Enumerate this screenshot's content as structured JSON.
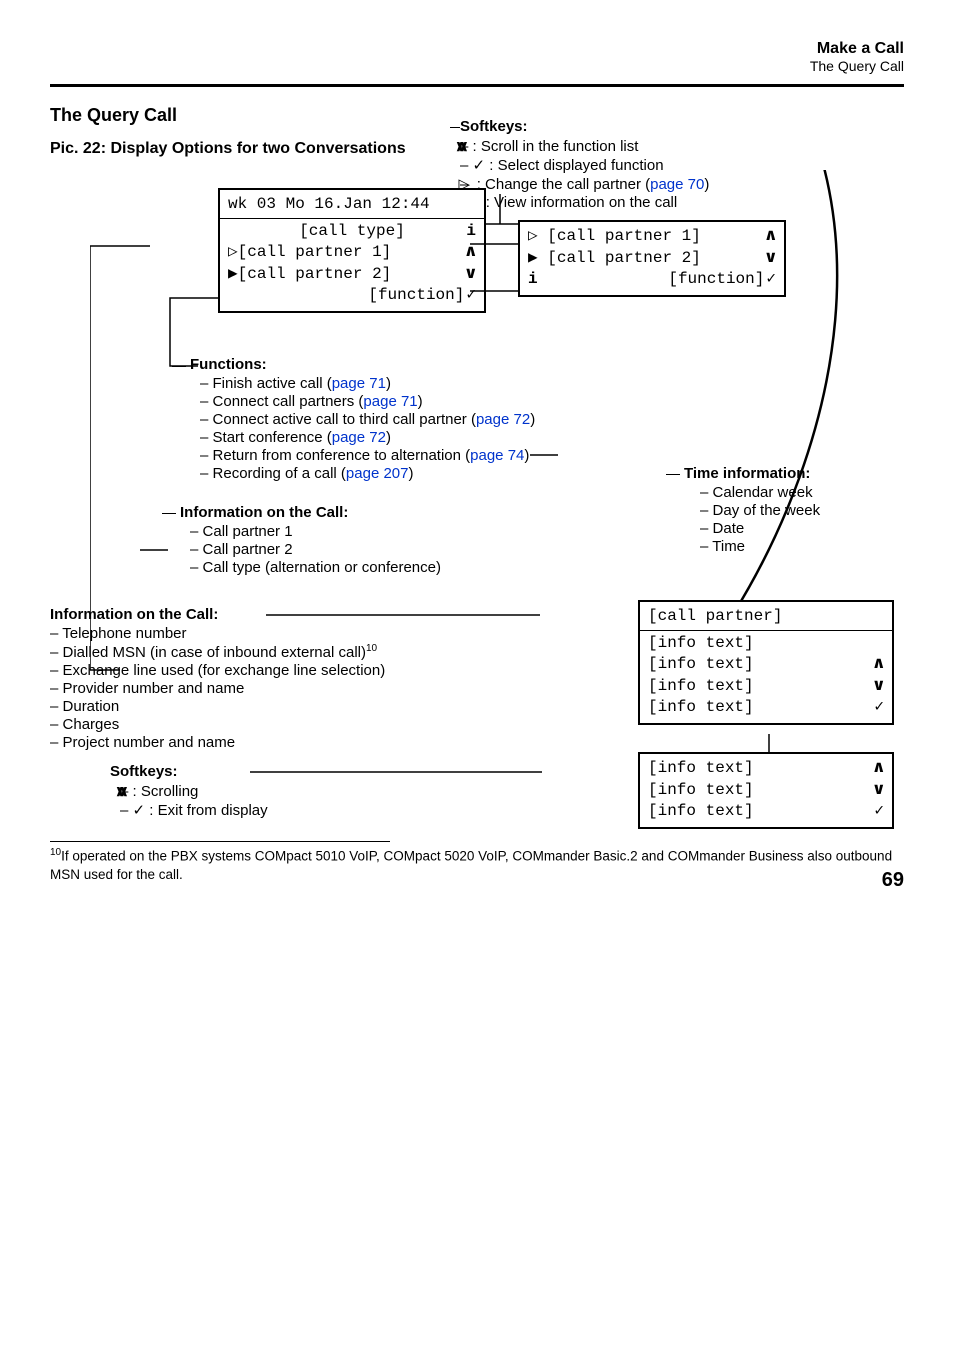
{
  "header": {
    "title": "Make a Call",
    "subtitle": "The Query Call"
  },
  "section_title": "The Query Call",
  "pic_title": "Pic. 22: Display Options for two Conversations",
  "softkeys_top": {
    "title": "Softkeys:",
    "items": [
      {
        "prefix_icon": "updown",
        "text": ": Scroll in the function list",
        "ref": ""
      },
      {
        "prefix_icon": "check",
        "text": ": Select displayed function",
        "ref": ""
      },
      {
        "prefix_icon": "play",
        "text": ": Change the call partner (",
        "ref": "page 70",
        "suffix": ")"
      },
      {
        "prefix_icon": "info",
        "text": ": View information on the call",
        "ref": ""
      }
    ]
  },
  "lcd_main": {
    "line1": "wk 03 Mo 16.Jan 12:44",
    "line2_left": "[call type]",
    "line3_left": "[call partner 1]",
    "line4_left": "[call partner 2]",
    "line5_left": "[function]"
  },
  "lcd_side": {
    "line1_left": "[call partner 1]",
    "line2_left": "[call partner 2]",
    "line3_left": "[function]"
  },
  "functions": {
    "title": "Functions:",
    "items": [
      {
        "text": "Finish active call (",
        "ref": "page 71",
        "suffix": ")"
      },
      {
        "text": "Connect call partners (",
        "ref": "page 71",
        "suffix": ")"
      },
      {
        "text": "Connect active call to third call partner (",
        "ref": "page 72",
        "suffix": ")"
      },
      {
        "text": "Start conference (",
        "ref": "page 72",
        "suffix": ")"
      },
      {
        "text": "Return from conference to alternation (",
        "ref": "page 74",
        "suffix": ")"
      },
      {
        "text": "Recording of a call (",
        "ref": "page 207",
        "suffix": ")"
      }
    ]
  },
  "time_info": {
    "title": "Time information:",
    "items": [
      "Calendar week",
      "Day of the week",
      "Date",
      "Time"
    ]
  },
  "info_call_1": {
    "title": "Information on the Call:",
    "items": [
      "Call partner 1",
      "Call partner 2",
      "Call type (alternation or conference)"
    ]
  },
  "info_call_2": {
    "title": "Information on the Call:",
    "items": [
      "Telephone number",
      "Dialled MSN (in case of inbound external call)",
      "Exchange line used (for exchange line selection)",
      "Provider number and name",
      "Duration",
      "Charges",
      "Project number and name"
    ],
    "sup_on_item": 1,
    "sup_text": "10"
  },
  "softkeys_bottom": {
    "title": "Softkeys:",
    "items": [
      {
        "prefix_icon": "updown",
        "text": ": Scrolling"
      },
      {
        "prefix_icon": "check",
        "text": ": Exit from display"
      }
    ]
  },
  "lcd_bottom": {
    "line1": "[call partner]",
    "lines_a": [
      "[info text]",
      "[info text]",
      "[info text]",
      "[info text]"
    ],
    "lines_b": [
      "[info text]",
      "[info text]",
      "[info text]"
    ]
  },
  "footnote": {
    "sup": "10",
    "text": "If operated on the PBX systems COMpact 5010 VoIP, COMpact 5020 VoIP, COMmander Basic.2 and COMmander Business also outbound MSN used for the call."
  },
  "page_number": "69",
  "icons": {
    "up": "∧",
    "down": "∨",
    "check": "✓",
    "play_hollow": "▷",
    "play_solid": "▶",
    "info": "i"
  }
}
